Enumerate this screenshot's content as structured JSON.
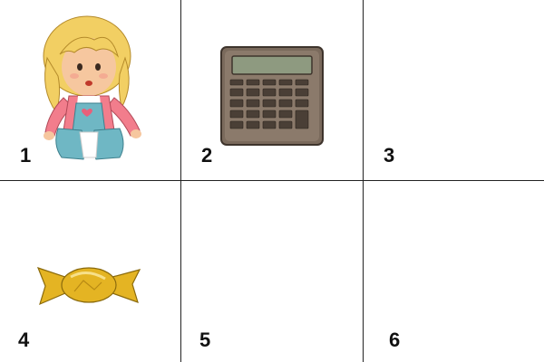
{
  "grid": {
    "cells": [
      {
        "number": "1",
        "picture": "doll"
      },
      {
        "number": "2",
        "picture": "calculator"
      },
      {
        "number": "3",
        "picture": ""
      },
      {
        "number": "4",
        "picture": "wrapped-candy"
      },
      {
        "number": "5",
        "picture": ""
      },
      {
        "number": "6",
        "picture": ""
      }
    ]
  },
  "colors": {
    "grid_line": "#222222",
    "calculator_body": "#7a6a5c",
    "calculator_screen": "#8e9a80",
    "candy": "#e4b423",
    "doll_hair": "#f2cf63",
    "doll_top": "#f27d8c",
    "doll_dress": "#6fb7c4"
  }
}
